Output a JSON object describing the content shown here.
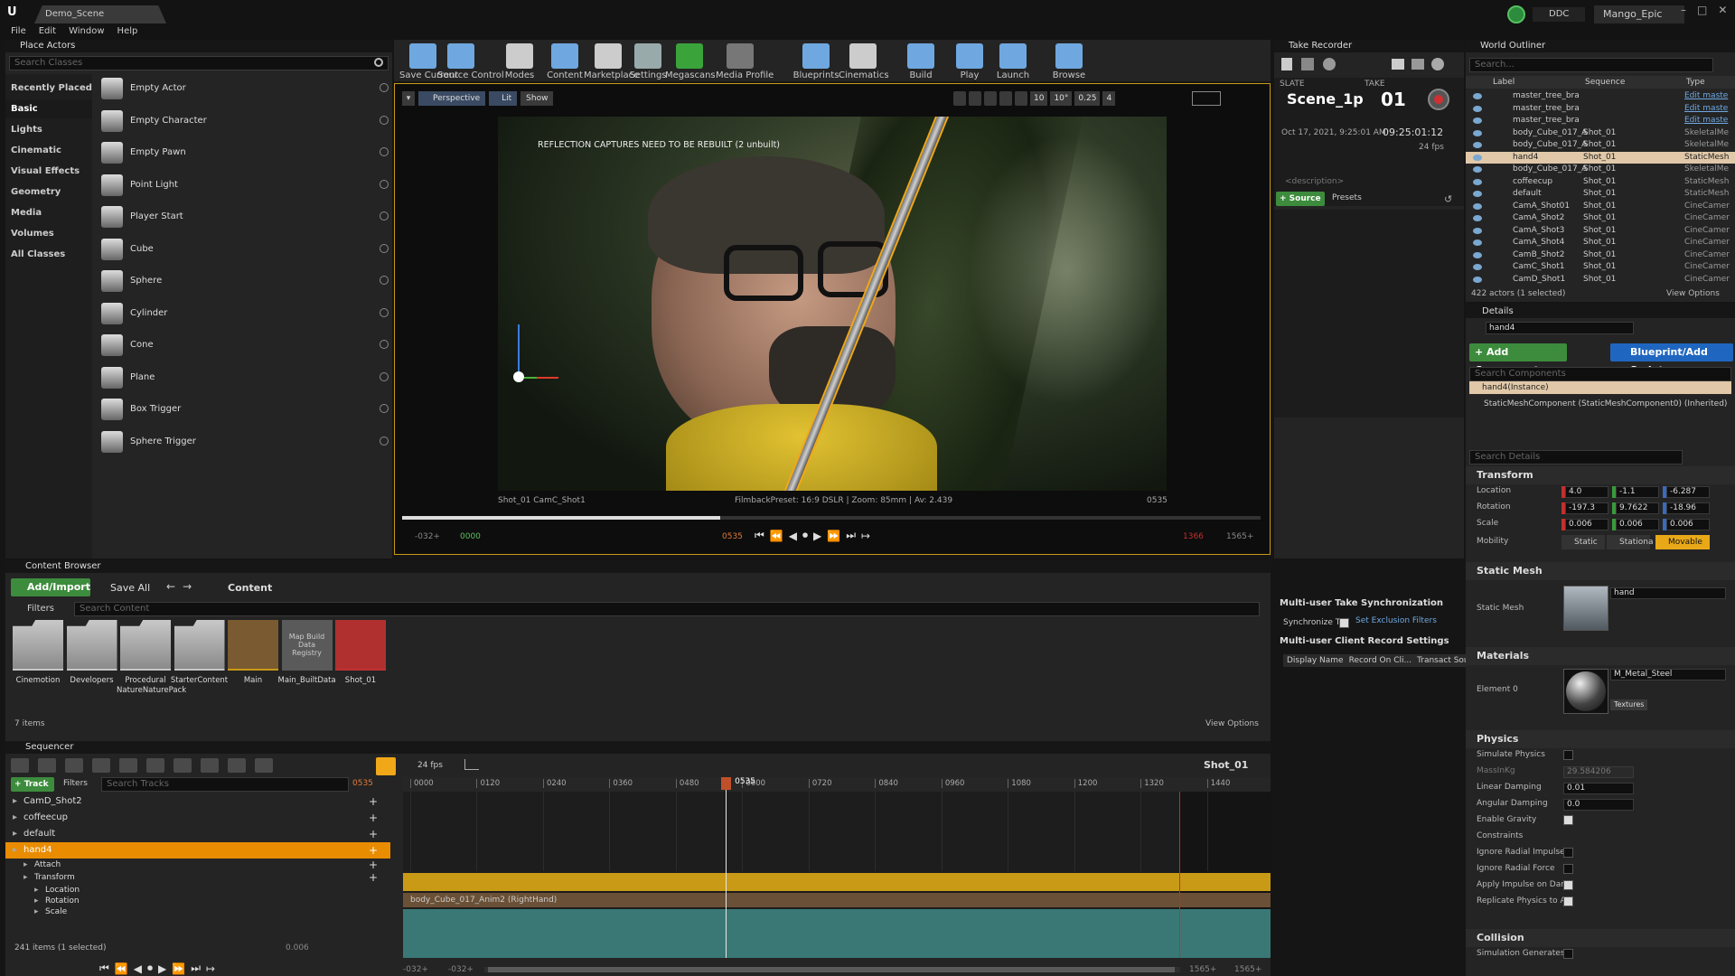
{
  "menu": {
    "logo": "U",
    "project_tab": "Demo_Scene",
    "items": [
      "File",
      "Edit",
      "Window",
      "Help"
    ],
    "ddc": "DDC",
    "user": "Mango_Epic"
  },
  "colors": {
    "accent": "#f0a818",
    "selection": "#ea8c00",
    "green": "#3d8c3d",
    "blue": "#1f66c0",
    "teal": "#3a7876",
    "gold": "#c99a16"
  },
  "place_actors": {
    "tab": "Place Actors",
    "search": "Search Classes",
    "categories": [
      "Recently Placed",
      "Basic",
      "Lights",
      "Cinematic",
      "Visual Effects",
      "Geometry",
      "Media",
      "Volumes",
      "All Classes"
    ],
    "selected": "Basic",
    "items": [
      "Empty Actor",
      "Empty Character",
      "Empty Pawn",
      "Point Light",
      "Player Start",
      "Cube",
      "Sphere",
      "Cylinder",
      "Cone",
      "Plane",
      "Box Trigger",
      "Sphere Trigger"
    ]
  },
  "toolbar": {
    "buttons": [
      "Save Current",
      "Source Control",
      "Modes",
      "Content",
      "Marketplace",
      "Settings",
      "Megascans",
      "Media Profile",
      "Blueprints",
      "Cinematics",
      "Build",
      "Play",
      "Launch",
      "Browse"
    ]
  },
  "viewport": {
    "mode": "Perspective",
    "lit": "Lit",
    "show": "Show",
    "warning": "REFLECTION CAPTURES NEED TO BE REBUILT (2 unbuilt)",
    "shot": "Shot_01  CamC_Shot1",
    "filmback": "FilmbackPreset: 16:9 DSLR | Zoom: 85mm | Av: 2.439",
    "frame": "0535",
    "snap_vals": [
      "10",
      "10°",
      "0.25",
      "4"
    ],
    "progress": 0.37,
    "t_start": "-032+",
    "t_in": "0000",
    "t_cur": "0535",
    "t_out": "1366",
    "t_end": "1565+"
  },
  "take_recorder": {
    "tab": "Take Recorder",
    "slate_label": "SLATE",
    "take_label": "TAKE",
    "slate": "Scene_1p",
    "take": "01",
    "date": "Oct 17, 2021, 9:25:01 AM",
    "timecode": "09:25:01:12",
    "fps": "24 fps",
    "description": "<description>",
    "source": "+ Source",
    "presets": "Presets",
    "sync_title": "Multi-user Take Synchronization",
    "sync_label": "Synchronize T...",
    "exclusion": "Set Exclusion Filters",
    "client_title": "Multi-user Client Record Settings",
    "columns": [
      "Display Name",
      "Record On Cli...",
      "Transact Sou..."
    ]
  },
  "outliner": {
    "tab": "World Outliner",
    "search": "Search...",
    "columns": [
      "Label",
      "Sequence",
      "Type"
    ],
    "rows": [
      {
        "label": "master_tree_bra",
        "seq": "",
        "type": "Edit maste",
        "link": true
      },
      {
        "label": "master_tree_bra",
        "seq": "",
        "type": "Edit maste",
        "link": true
      },
      {
        "label": "master_tree_bra",
        "seq": "",
        "type": "Edit maste",
        "link": true
      },
      {
        "label": "body_Cube_017_A",
        "seq": "Shot_01",
        "type": "SkeletalMe"
      },
      {
        "label": "body_Cube_017_A",
        "seq": "Shot_01",
        "type": "SkeletalMe"
      },
      {
        "label": "hand4",
        "seq": "Shot_01",
        "type": "StaticMesh",
        "sel": true
      },
      {
        "label": "body_Cube_017_A",
        "seq": "Shot_01",
        "type": "SkeletalMe"
      },
      {
        "label": "coffeecup",
        "seq": "Shot_01",
        "type": "StaticMesh"
      },
      {
        "label": "default",
        "seq": "Shot_01",
        "type": "StaticMesh"
      },
      {
        "label": "CamA_Shot01",
        "seq": "Shot_01",
        "type": "CineCamer"
      },
      {
        "label": "CamA_Shot2",
        "seq": "Shot_01",
        "type": "CineCamer"
      },
      {
        "label": "CamA_Shot3",
        "seq": "Shot_01",
        "type": "CineCamer"
      },
      {
        "label": "CamA_Shot4",
        "seq": "Shot_01",
        "type": "CineCamer"
      },
      {
        "label": "CamB_Shot2",
        "seq": "Shot_01",
        "type": "CineCamer"
      },
      {
        "label": "CamC_Shot1",
        "seq": "Shot_01",
        "type": "CineCamer"
      },
      {
        "label": "CamD_Shot1",
        "seq": "Shot_01",
        "type": "CineCamer"
      }
    ],
    "count": "422 actors (1 selected)",
    "view_options": "View Options"
  },
  "details": {
    "tab": "Details",
    "name": "hand4",
    "add_component": "+ Add Component",
    "blueprint": "Blueprint/Add Script",
    "search_components": "Search Components",
    "instance": "hand4(Instance)",
    "component": "StaticMeshComponent (StaticMeshComponent0) (Inherited)",
    "search_details": "Search Details",
    "transform": {
      "title": "Transform",
      "location": {
        "label": "Location",
        "x": "4.0",
        "y": "-1.1",
        "z": "-6.287"
      },
      "rotation": {
        "label": "Rotation",
        "x": "-197.3",
        "y": "9.7622",
        "z": "-18.96"
      },
      "scale": {
        "label": "Scale",
        "x": "0.006",
        "y": "0.006",
        "z": "0.006"
      },
      "mobility": {
        "label": "Mobility",
        "static": "Static",
        "stationary": "Stationa",
        "movable": "Movable"
      }
    },
    "static_mesh": {
      "title": "Static Mesh",
      "label": "Static Mesh",
      "value": "hand"
    },
    "materials": {
      "title": "Materials",
      "label": "Element 0",
      "value": "M_Metal_Steel",
      "textures": "Textures"
    },
    "physics": {
      "title": "Physics",
      "simulate": "Simulate Physics",
      "mass": "MassInKg",
      "mass_val": "29.584206",
      "linear": "Linear Damping",
      "linear_val": "0.01",
      "angular": "Angular Damping",
      "angular_val": "0.0",
      "gravity": "Enable Gravity",
      "constraints": "Constraints",
      "radial_impulse": "Ignore Radial Impulse",
      "radial_force": "Ignore Radial Force",
      "apply_impulse": "Apply Impulse on Dama",
      "replicate": "Replicate Physics to Au"
    },
    "collision": {
      "title": "Collision",
      "sim_gen": "Simulation Generates H"
    }
  },
  "content_browser": {
    "tab": "Content Browser",
    "add": "Add/Import",
    "save": "Save All",
    "path": "Content",
    "filters": "Filters",
    "search": "Search Content",
    "items": [
      {
        "name": "Cinemotion",
        "kind": "folder"
      },
      {
        "name": "Developers",
        "kind": "folder"
      },
      {
        "name": "Procedural NatureNaturePack",
        "kind": "folder"
      },
      {
        "name": "StarterContent",
        "kind": "folder"
      },
      {
        "name": "Main",
        "kind": "level"
      },
      {
        "name": "Main_BuiltData",
        "kind": "data",
        "thumb": "Map Build Data Registry"
      },
      {
        "name": "Shot_01",
        "kind": "seq"
      }
    ],
    "count": "7 items",
    "view_options": "View Options"
  },
  "sequencer": {
    "tab": "Sequencer",
    "fps": "24 fps",
    "name": "Shot_01",
    "track": "Track",
    "filters": "Filters",
    "search": "Search Tracks",
    "frame": "0535",
    "ticks": [
      "0000",
      "0120",
      "0240",
      "0360",
      "0480",
      "0600",
      "0720",
      "0840",
      "0960",
      "1080",
      "1200",
      "1320",
      "1440"
    ],
    "tracks": [
      {
        "name": "CamD_Shot2",
        "indent": 0
      },
      {
        "name": "coffeecup",
        "indent": 0
      },
      {
        "name": "default",
        "indent": 0
      },
      {
        "name": "hand4",
        "indent": 0,
        "sel": true
      },
      {
        "name": "Attach",
        "indent": 1
      },
      {
        "name": "Transform",
        "indent": 1
      },
      {
        "name": "Location",
        "indent": 2
      },
      {
        "name": "Rotation",
        "indent": 2
      },
      {
        "name": "Scale",
        "indent": 2
      }
    ],
    "attach_clip": "body_Cube_017_Anim2 (RightHand)",
    "count": "241 items (1 selected)",
    "value": "0.006",
    "t_start": "-032+",
    "t_start2": "-032+",
    "t_end": "1565+",
    "t_end2": "1565+",
    "playhead": 0.372,
    "end_mark": 0.895
  }
}
